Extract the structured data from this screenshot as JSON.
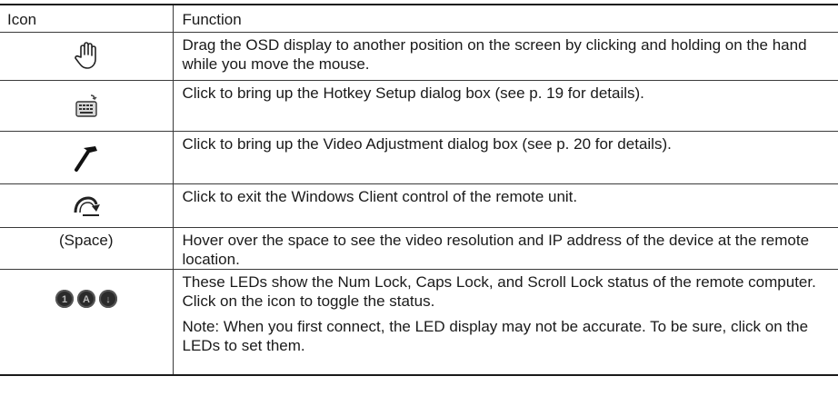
{
  "table": {
    "headers": {
      "icon": "Icon",
      "function": "Function"
    },
    "rows": [
      {
        "icon": "hand-icon",
        "function": "Drag the OSD display to another position on the screen by clicking and holding on the hand while you move the mouse."
      },
      {
        "icon": "keyboard-icon",
        "function": "Click to bring up the Hotkey Setup dialog box (see p. 19 for details)."
      },
      {
        "icon": "hammer-icon",
        "function": "Click to bring up the Video Adjustment dialog box (see p. 20 for details)."
      },
      {
        "icon": "exit-arrow-icon",
        "function": "Click to exit the Windows Client control of the remote unit."
      },
      {
        "icon_text": "(Space)",
        "function": "Hover over the space to see the video resolution and IP address of the device at the remote location."
      },
      {
        "icon": "lock-leds-icon",
        "led_letters": [
          "1",
          "A",
          "↓"
        ],
        "function": "These LEDs show the Num Lock, Caps Lock, and Scroll Lock status of the remote computer. Click on the icon to toggle the status.",
        "note": "Note: When you first connect, the LED display may not be accurate. To be sure, click on the LEDs to set them."
      }
    ]
  }
}
